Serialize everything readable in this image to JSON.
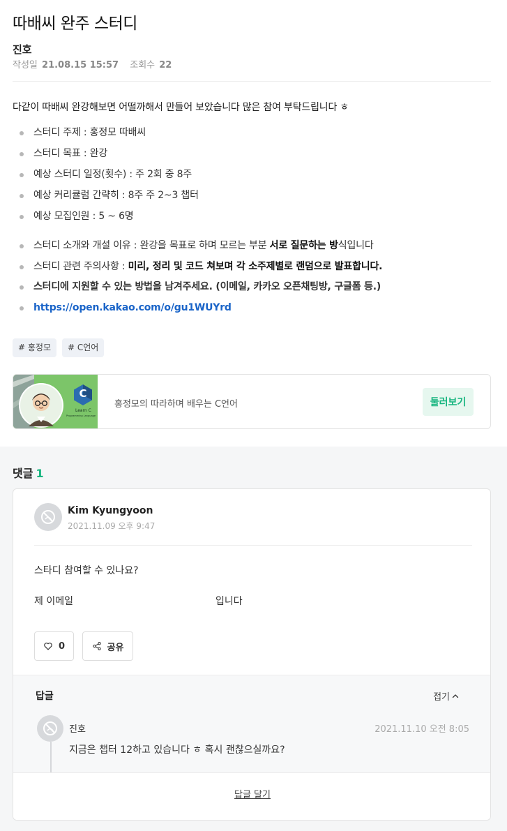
{
  "post": {
    "title": "따배씨 완주 스터디",
    "author": "진호",
    "date_label": "작성일",
    "date_value": "21.08.15 15:57",
    "views_label": "조회수",
    "views_value": "22",
    "intro": "다같이 따배씨 완강해보면 어떨까해서 만들어 보았습니다 많은 참여 부탁드립니다 ㅎ",
    "details": [
      "스터디 주제 : 홍정모 따배씨",
      "스터디 목표 : 완강",
      "예상 스터디 일정(횟수) : 주 2회 중 8주",
      "예상 커리큘럼 간략히 : 8주 주 2~3 챕터",
      "예상 모집인원 : 5 ~ 6명"
    ],
    "reason_prefix": "스터디 소개와 개설 이유 : 완강을 목표로 하며 모르는 부분 ",
    "reason_bold": "서로 질문하는 방",
    "reason_suffix": "식입니다",
    "notes_prefix": "스터디 관련 주의사항 : ",
    "notes_bold": "미리, 정리 및 코드 쳐보며 각 소주제별로 랜덤으로 발표합니다.",
    "apply": "스터디에 지원할 수 있는 방법을 남겨주세요. (이메일, 카카오 오픈채팅방, 구글폼 등.)",
    "link": "https://open.kakao.com/o/gu1WUYrd",
    "tags": [
      "# 홍정모",
      "# C언어"
    ]
  },
  "course": {
    "thumb_logo": "C",
    "thumb_text": "Learn C",
    "thumb_subtext": "Programming Language",
    "title": "홍정모의 따라하며 배우는 C언어",
    "button": "둘러보기"
  },
  "comments": {
    "label": "댓글",
    "count": "1",
    "items": [
      {
        "name": "Kim Kyungyoon",
        "date": "2021.11.09 오후 9:47",
        "text1": "스타디 참여할 수 있나요?",
        "text2": "제 이메일",
        "text3": "입니다",
        "likes": "0",
        "share": "공유"
      }
    ],
    "reply_label": "답글",
    "fold_label": "접기",
    "reply": {
      "name": "진호",
      "date": "2021.11.10 오전 8:05",
      "text": "지금은 챕터 12하고 있습니다 ㅎ 혹시 괜찮으실까요?"
    },
    "write_reply": "답글 달기"
  },
  "icons": {
    "like": "heart-icon",
    "share": "share-icon",
    "fold": "chevron-up-icon",
    "avatar": "default-avatar-icon"
  },
  "colors": {
    "accent": "#16b57f",
    "link": "#1a64c8"
  }
}
